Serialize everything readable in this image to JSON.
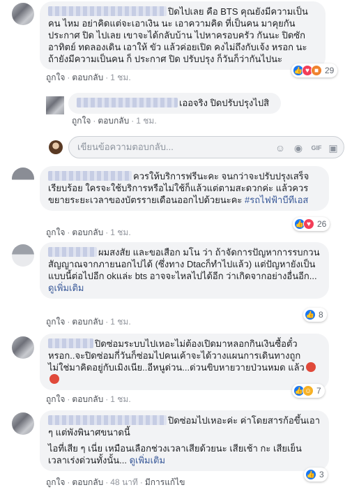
{
  "comments": [
    {
      "text": "ปิดไปเลย คือ BTS คุณยังมีความเป็นคน ไหม อย่าคิดแต่จะเอาเงิน นะ เอาความคิด ที่เป็นคน มาคุยกัน ประกาศ ปิด ไปเลย เขาจะได้กลับบ้าน ไปหาครอบครัว กันนะ ปิดซัก อาทิตย์ ทดลองเดิน เอาให้ ขัว แล้วค่อยเปิด คงไม่ถึงกับเจ้ง หรอก นะ ถ้ายังมีความเป็นคน ก็ ประกาศ ปิด ปรับปรุง ก็วันก็ว่ากันไปนะ",
      "like": "ถูกใจ",
      "reply": "ตอบกลับ",
      "time": "1 ชม.",
      "reaction_count": "29"
    },
    {
      "text": "เออจริง ปิดปรับปรุงไปสิ",
      "like": "ถูกใจ",
      "reply": "ตอบกลับ",
      "time": "1 ชม."
    },
    {
      "text": "ควรให้บริการฟรีนะคะ จนกว่าจะปรับปรุงเสร็จเรียบร้อย ใครจะใช้บริการหรือไม่ใช้ก็แล้วแต่ตามสะดวกค่ะ แล้วควรขยายระยะเวลาของบัตรรายเดือนออกไปด้วยนะคะ",
      "hashtag": "#รถไฟฟ้าบีทีเอส",
      "like": "ถูกใจ",
      "reply": "ตอบกลับ",
      "time": "1 ชม.",
      "reaction_count": "26"
    },
    {
      "text": "ผมสงสัย และขอเสือก มโน ว่า ถ้าจัดการปัญหาการรบกวนสัญญาณจากภายนอกไปได้ (ซึ่งทาง Dtacก็ทำไปแล้ว) แต่ปัญหายังเป็นแบบนี้ต่อไปอีก okแล่ะ bts อาจจะไหลไปได้อีก ว่าเกิดจากอย่างอื่นอีก...",
      "more": "ดูเพิ่มเติม",
      "like": "ถูกใจ",
      "reply": "ตอบกลับ",
      "time": "1 ชม.",
      "reaction_count": "8"
    },
    {
      "text": "ปิดซ่อมระบบไปเหอะไม่ต้องเปิดมาหลอกกินเงินซื้อตั๋ว หรอก..จะปิดซ่อมกี่วันก็ซ่อมไปคนเค้าจะได้วางแผนการเดินทางถูก ไม่ใช่มาคิดอยู่กับเมิงเนีย..อีหนูด่วน...ด่วนขิบหายวายป่วนหมด แล้ว",
      "like": "ถูกใจ",
      "reply": "ตอบกลับ",
      "time": "1 ชม.",
      "reaction_count": "7"
    },
    {
      "text": "ปิดซ่อมไปเหอะค่ะ ค่าโดยสารก้อขึ้นเอา ๆ แต่พังพินาศขนาดนี้",
      "text2": "ไอที่เสีย ๆ เนี่ย เหมือนเลือกช่วงเวลาเสียด้วยนะ เสียเช้า กะ เสียเย็น เวลาเร่งด่วนทั้งนั้น...",
      "more": "ดูเพิ่มเติม",
      "like": "ถูกใจ",
      "reply": "ตอบกลับ",
      "time": "48 นาที",
      "edited": "มีการแก้ไข",
      "reaction_count": "3"
    }
  ],
  "reply_box": {
    "placeholder": "เขียนข้อความตอบกลับ..."
  },
  "icons": {
    "emoji": "smiley-icon",
    "camera": "camera-icon",
    "gif": "gif-icon",
    "sticker": "sticker-icon"
  },
  "colors": {
    "link": "#385898",
    "like": "#1877f2",
    "love": "#f33e58",
    "angry": "#f0822d",
    "haha": "#f7b125"
  }
}
